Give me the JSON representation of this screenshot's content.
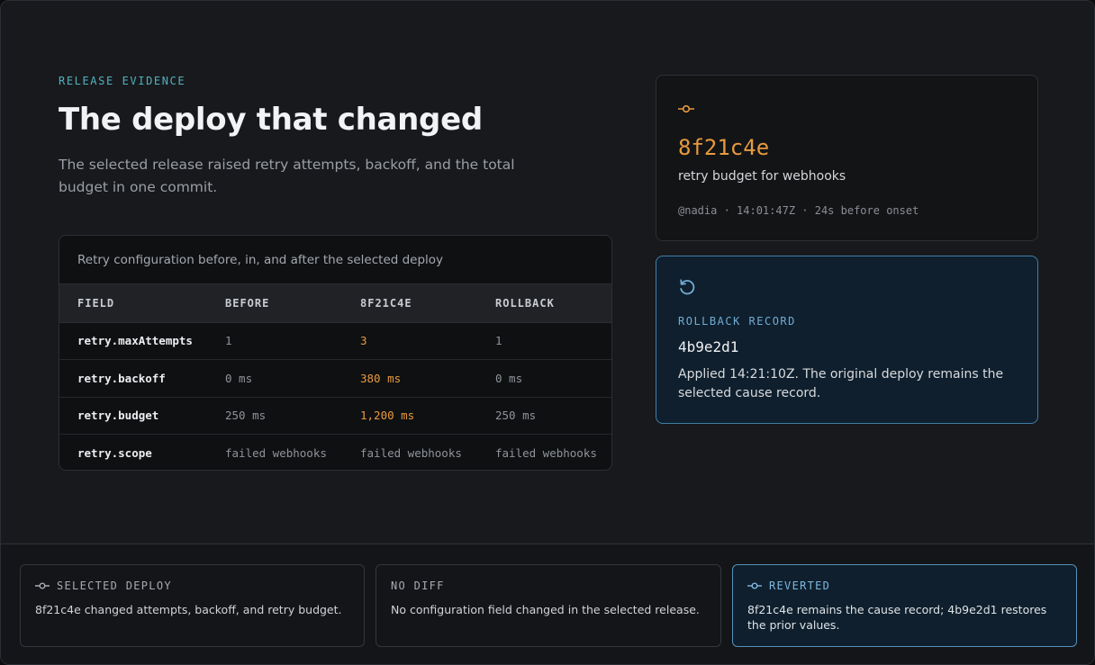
{
  "hero": {
    "eyebrow": "RELEASE EVIDENCE",
    "title": "The deploy that changed",
    "lead": "The selected release raised retry attempts, backoff, and the total budget in one commit."
  },
  "table": {
    "caption": "Retry configuration before, in, and after the selected deploy",
    "headers": [
      "FIELD",
      "BEFORE",
      "8F21C4E",
      "ROLLBACK"
    ],
    "rows": [
      {
        "field": "retry.maxAttempts",
        "before": "1",
        "deploy": "3",
        "rollback": "1",
        "changed": true
      },
      {
        "field": "retry.backoff",
        "before": "0 ms",
        "deploy": "380 ms",
        "rollback": "0 ms",
        "changed": true
      },
      {
        "field": "retry.budget",
        "before": "250 ms",
        "deploy": "1,200 ms",
        "rollback": "250 ms",
        "changed": true
      },
      {
        "field": "retry.scope",
        "before": "failed webhooks",
        "deploy": "failed webhooks",
        "rollback": "failed webhooks",
        "changed": false
      }
    ]
  },
  "commit": {
    "icon": "commit-icon",
    "hash": "8f21c4e",
    "message": "retry budget for webhooks",
    "meta": "@nadia · 14:01:47Z · 24s before onset"
  },
  "rollback": {
    "icon": "rollback-icon",
    "label": "ROLLBACK RECORD",
    "hash": "4b9e2d1",
    "text": "Applied 14:21:10Z. The original deploy remains the selected cause record."
  },
  "summary": [
    {
      "icon": "commit-icon",
      "title": "SELECTED DEPLOY",
      "text": "8f21c4e changed attempts, backoff, and retry budget."
    },
    {
      "icon": "",
      "title": "NO DIFF",
      "text": "No configuration field changed in the selected release."
    },
    {
      "icon": "commit-icon",
      "title": "REVERTED",
      "text": "8f21c4e remains the cause record; 4b9e2d1 restores the prior values."
    }
  ],
  "colors": {
    "accent_teal": "#4fb3bf",
    "changed_orange": "#e79a3f",
    "rollback_blue": "#3f7fa8"
  }
}
